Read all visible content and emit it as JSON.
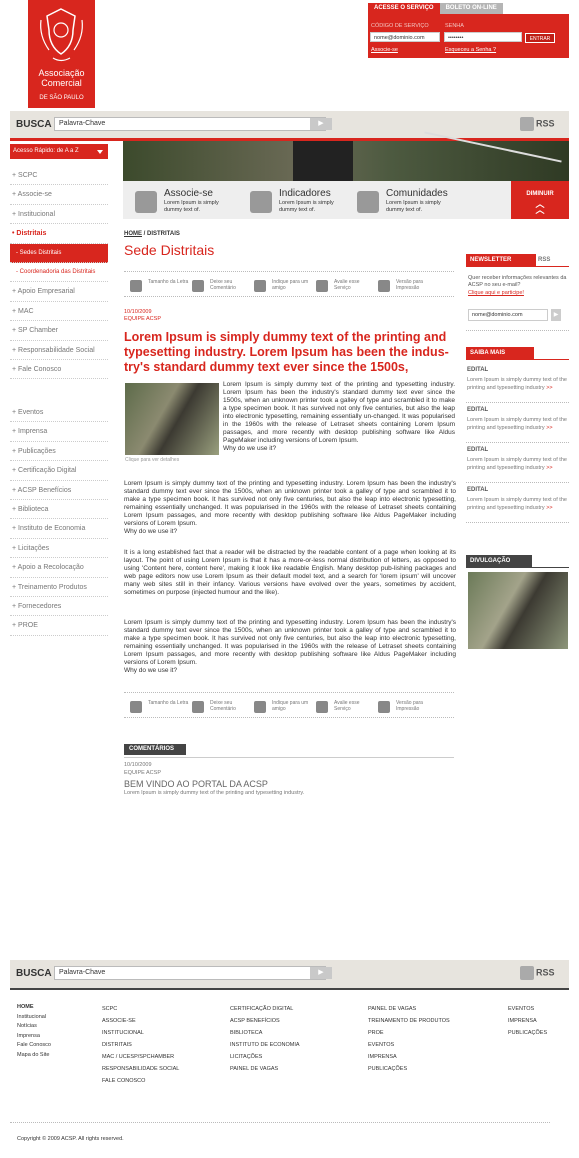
{
  "logo": {
    "line1": "Associação",
    "line2": "Comercial",
    "line3": "DE SÃO PAULO"
  },
  "header": {
    "tab_active": "ACESSE O SERVIÇO",
    "tab_inactive": "BOLETO ON-LINE",
    "code_label": "CÓDIGO DE SERVIÇO",
    "pass_label": "SENHA",
    "code_value": "nome@dominio.com",
    "pass_value": "••••••••",
    "submit": "ENTRAR",
    "link_register": "Associe-se",
    "link_forgot": "Esqueceu a Senha ?"
  },
  "search": {
    "label": "BUSCA",
    "placeholder": "Palavra-Chave",
    "rss": "RSS"
  },
  "quick": "Acesso Rápido: de A a Z",
  "menu1": [
    "+ SCPC",
    "+ Associe-se",
    "+ Institucional",
    "• Distritais",
    "- Sedes Distritais",
    "- Coordenadoria das Distritais",
    "+ Apoio Empresarial",
    "+ MAC",
    "+ SP Chamber",
    "+ Responsabilidade Social",
    "+ Fale Conosco"
  ],
  "menu2": [
    "+ Eventos",
    "+ Imprensa",
    "+ Publicações",
    "+ Certificação Digital",
    "+ ACSP Benefícios",
    "+ Biblioteca",
    "+ Instituto de Economia",
    "+ Licitações",
    "+ Apoio a Recolocação",
    "+ Treinamento Produtos",
    "+ Fornecedores",
    "+ PROE"
  ],
  "features": [
    {
      "title": "Associe-se",
      "desc": "Lorem Ipsum is simply dummy text of."
    },
    {
      "title": "Indicadores",
      "desc": "Lorem Ipsum is simply dummy text of."
    },
    {
      "title": "Comunidades",
      "desc": "Lorem Ipsum is simply dummy text of."
    }
  ],
  "diminuir": "DIMINUIR",
  "breadcrumb": {
    "home": "HOME",
    "sep": " / ",
    "current": "DISTRITAIS"
  },
  "page_title": "Sede Distritais",
  "tools": [
    "Tamanho da Letra",
    "Deixe seu Comentário",
    "Indique para um amigo",
    "Avalie esse Serviço",
    "Versão para Impressão"
  ],
  "article": {
    "date": "10/10/2009",
    "team": "EQUIPE ACSP",
    "headline": "Lorem Ipsum is simply dummy text of the printing and typesetting industry. Lorem Ipsum has been the indus-try's standard dummy text ever since the 1500s,",
    "photo_caption": "Clique para ver detalhes",
    "p1": "Lorem Ipsum is simply dummy text of the printing and typesetting industry. Lorem Ipsum has been the industry's standard dummy text ever since the 1500s, when an unknown printer took a galley of type and scrambled it to make a type specimen book. It has survived not only five centuries, but also the leap into electronic typesetting, remaining essentially un-changed. It was popularised in the 1960s with the release of Letraset sheets containing Lorem Ipsum passages, and more recently with desktop publishing software like Aldus PageMaker including versions of Lorem Ipsum.",
    "q1": "Why do we use it?",
    "p2": "Lorem Ipsum is simply dummy text of the printing and typesetting industry. Lorem Ipsum has been the industry's standard dummy text ever since the 1500s, when an unknown printer took a galley of type and scrambled it to make a type specimen book. It has survived not only five centuries, but also the leap into electronic typesetting, remaining essentially unchanged. It was popularised in the 1960s with the release of Letraset sheets containing Lorem Ipsum passages, and more recently with desktop publishing software like Aldus PageMaker including versions of Lorem Ipsum.",
    "q2": "Why do we use it?",
    "p3": "It is a long established fact that a reader will be distracted by the readable content of a page when looking at its layout. The point of using Lorem Ipsum is that it has a more-or-less normal distribution of letters, as opposed to using 'Content here, content here', making it look like readable English. Many desktop pub-lishing packages and web page editors now use Lorem Ipsum as their default model text, and a search for 'lorem ipsum' will uncover many web sites still in their infancy. Various versions have evolved over the years, sometimes by accident, sometimes on purpose (injected humour and the like).",
    "p4": "Lorem Ipsum is simply dummy text of the printing and typesetting industry. Lorem Ipsum has been the industry's standard dummy text ever since the 1500s, when an unknown printer took a galley of type and scrambled it to make a type specimen book. It has survived not only five centuries, but also the leap into electronic typesetting, remaining essentially unchanged. It was popularised in the 1960s with the release of Letraset sheets containing Lorem Ipsum passages, and more recently with desktop publishing software like Aldus PageMaker including versions of Lorem Ipsum.",
    "q3": "Why do we use it?"
  },
  "comments": {
    "header": "COMENTÁRIOS",
    "date": "10/10/2009",
    "team": "EQUIPE ACSP",
    "title": "BEM VINDO AO PORTAL DA ACSP",
    "text": "Lorem Ipsum is simply dummy text of the printing and typesetting industry."
  },
  "newsletter": {
    "tab": "NEWSLETTER",
    "tab2": "RSS",
    "text": "Quer receber informações relevantes da ACSP no seu e-mail?",
    "link": "Clique aqui e participe!",
    "field": "nome@dominio.com"
  },
  "saiba": {
    "header": "SAIBA MAIS",
    "items": [
      {
        "title": "EDITAL",
        "text": "Lorem Ipsum is simply dummy text of the printing and typesetting industry",
        "more": ">>"
      },
      {
        "title": "EDITAL",
        "text": "Lorem Ipsum is simply dummy text of the printing and typesetting industry",
        "more": ">>"
      },
      {
        "title": "EDITAL",
        "text": "Lorem Ipsum is simply dummy text of the printing and typesetting industry",
        "more": ">>"
      },
      {
        "title": "EDITAL",
        "text": "Lorem Ipsum is simply dummy text of the printing and typesetting industry",
        "more": ">>"
      }
    ]
  },
  "divulgacao": "DIVULGAÇÃO",
  "footer": {
    "col1": [
      "HOME",
      "Institucional",
      "Notícias",
      "Imprensa",
      "Fale Conosco",
      "Mapa do Site"
    ],
    "col2": [
      "SCPC",
      "ASSOCIE-SE",
      "INSTITUCIONAL",
      "DISTRITAIS",
      "MAC / UCESP/SPCHAMBER",
      "RESPONSABILIDADE SOCIAL",
      "FALE CONOSCO"
    ],
    "col3": [
      "CERTIFICAÇÃO DIGITAL",
      "ACSP BENEFÍCIOS",
      "BIBLIOTECA",
      "INSTITUTO DE ECONOMIA",
      "LICITAÇÕES",
      "PAINEL DE VAGAS"
    ],
    "col4": [
      "PAINEL DE VAGAS",
      "TREINAMENTO DE PRODUTOS",
      "PROE",
      "EVENTOS",
      "IMPRENSA",
      "PUBLICAÇÕES"
    ],
    "col5": [
      "EVENTOS",
      "IMPRENSA",
      "PUBLICAÇÕES"
    ],
    "copyright": "Copyright © 2009 ACSP. All rights reserved."
  }
}
